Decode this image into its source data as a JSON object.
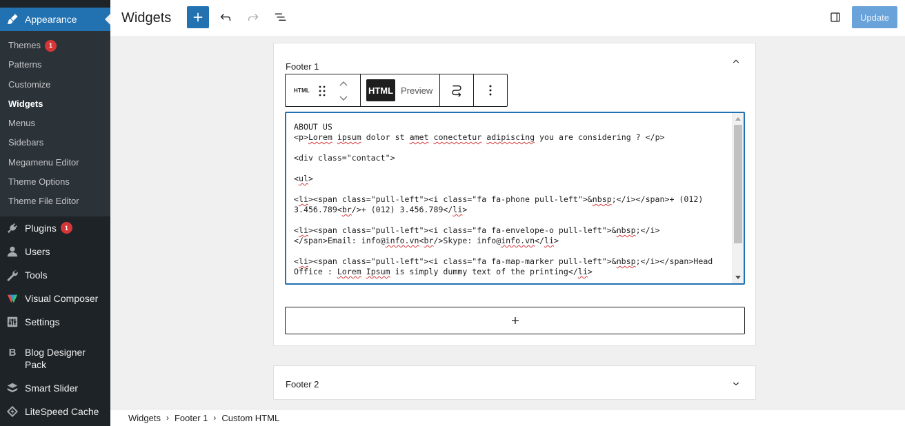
{
  "sidebar": {
    "appearance": "Appearance",
    "submenu": [
      {
        "label": "Themes",
        "badge": "1"
      },
      {
        "label": "Patterns"
      },
      {
        "label": "Customize"
      },
      {
        "label": "Widgets"
      },
      {
        "label": "Menus"
      },
      {
        "label": "Sidebars"
      },
      {
        "label": "Megamenu Editor"
      },
      {
        "label": "Theme Options"
      },
      {
        "label": "Theme File Editor"
      }
    ],
    "plugins": "Plugins",
    "plugins_badge": "1",
    "users": "Users",
    "tools": "Tools",
    "visual_composer": "Visual Composer",
    "settings": "Settings",
    "blog_designer": "Blog Designer Pack",
    "smart_slider": "Smart Slider",
    "litespeed": "LiteSpeed Cache"
  },
  "header": {
    "title": "Widgets",
    "update_label": "Update"
  },
  "footer1": {
    "title": "Footer 1"
  },
  "toolbar": {
    "block_icon_label": "HTML",
    "html_tab": "HTML",
    "preview_tab": "Preview"
  },
  "editor": {
    "lines": [
      "ABOUT US",
      "<p>Lorem ipsum dolor st amet conectetur adipiscing you are considering ? </p>",
      "",
      "<div class=\"contact\">",
      "",
      "<ul>",
      "",
      "<li><span class=\"pull-left\"><i class=\"fa fa-phone pull-left\">&nbsp;</i></span>+ (012)",
      "3.456.789<br/>+ (012) 3.456.789</li>",
      "",
      "<li><span class=\"pull-left\"><i class=\"fa fa-envelope-o pull-left\">&nbsp;</i>",
      "</span>Email: info@info.vn<br/>Skype: info@info.vn</li>",
      "",
      "<li><span class=\"pull-left\"><i class=\"fa fa-map-marker pull-left\">&nbsp;</i></span>Head",
      "Office : Lorem Ipsum is simply dummy text of the printing</li>"
    ]
  },
  "footer2": {
    "title": "Footer 2"
  },
  "breadcrumb": [
    "Widgets",
    "Footer 1",
    "Custom HTML"
  ],
  "colors": {
    "accent": "#2271b1",
    "sidebar_bg": "#1d2327",
    "submenu_bg": "#2c3338",
    "badge": "#d63638"
  }
}
